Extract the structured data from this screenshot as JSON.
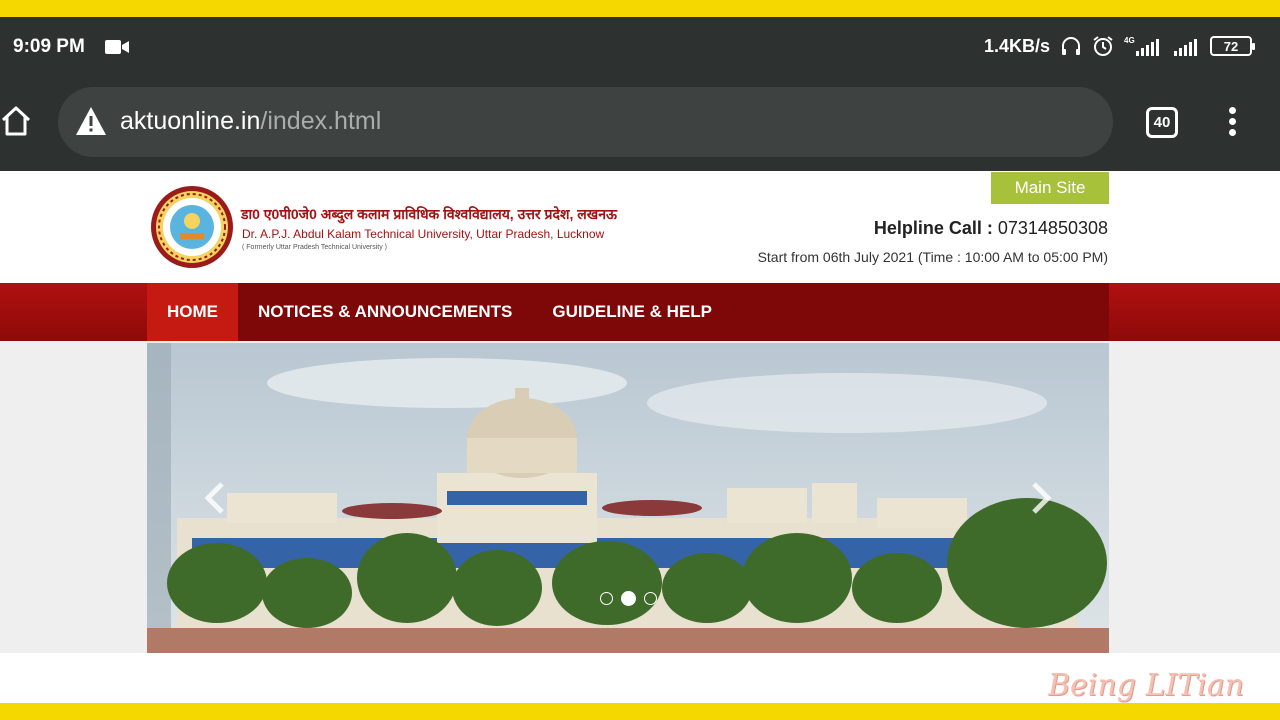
{
  "status_bar": {
    "time": "9:09 PM",
    "network_speed": "1.4KB/s",
    "network_type": "4G",
    "battery": "72"
  },
  "browser": {
    "url_host": "aktuonline.in",
    "url_path": "/index.html",
    "tab_count": "40"
  },
  "site": {
    "name_hindi": "डा0 ए0पी0जे0 अब्दुल कलाम प्राविधिक विश्वविद्यालय, उत्तर प्रदेश, लखनऊ",
    "name_english": "Dr. A.P.J. Abdul Kalam Technical University, Uttar Pradesh, Lucknow",
    "formerly": "( Formerly Uttar Pradesh Technical University )",
    "main_site_label": "Main Site",
    "helpline_label": "Helpline Call :",
    "helpline_number": "07314850308",
    "schedule": "Start from 06th July 2021 (Time : 10:00 AM to 05:00 PM)"
  },
  "nav": {
    "items": [
      {
        "label": "HOME"
      },
      {
        "label": "NOTICES & ANNOUNCEMENTS"
      },
      {
        "label": "GUIDELINE & HELP"
      }
    ]
  },
  "carousel": {
    "slide_count": 3,
    "active_slide": 2
  },
  "watermark": "Being LITian",
  "colors": {
    "nav_red": "#7e0707",
    "nav_active": "#c41a12",
    "main_site_green": "#a7c13b",
    "frame_yellow": "#f5d800"
  }
}
